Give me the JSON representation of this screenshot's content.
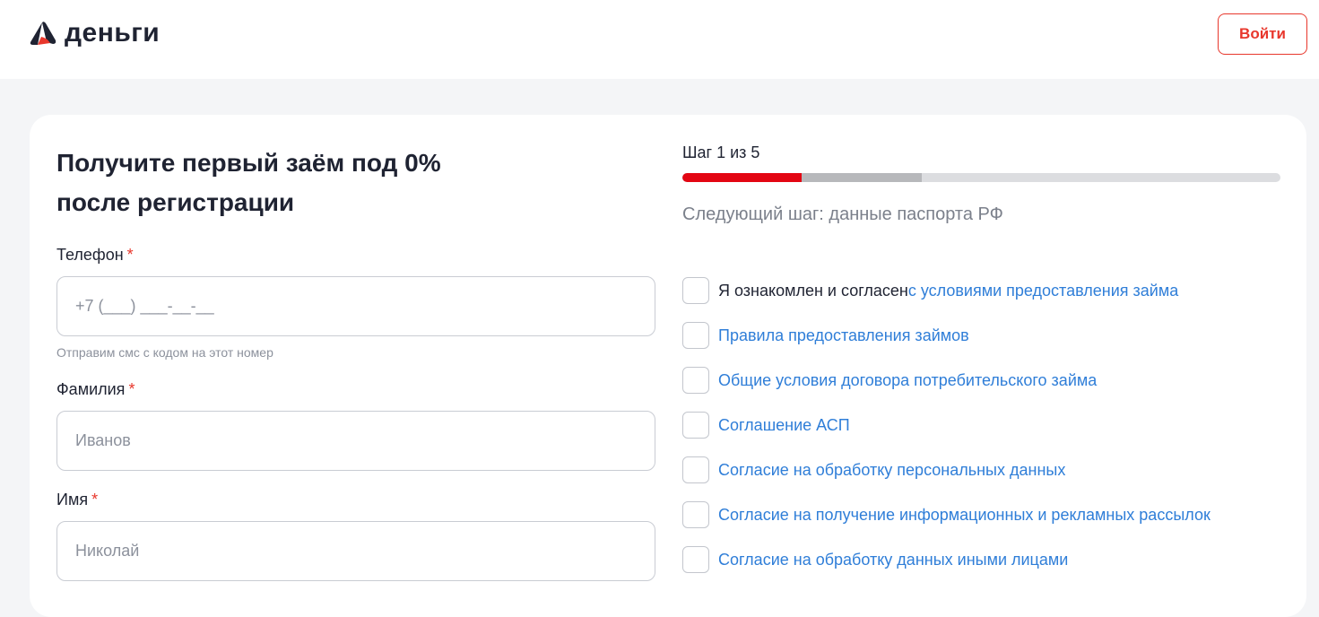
{
  "header": {
    "logo_text": "деньги",
    "login_label": "Войти"
  },
  "colors": {
    "accent": "#e8372c",
    "link": "#2f7ed8",
    "progress_active": "#e30613"
  },
  "form": {
    "title_line1": "Получите первый заём под 0%",
    "title_line2": "после регистрации",
    "phone": {
      "label": "Телефон",
      "required_mark": "*",
      "placeholder": "+7 (___) ___-__-__",
      "hint": "Отправим смс с кодом на этот номер"
    },
    "surname": {
      "label": "Фамилия",
      "required_mark": "*",
      "placeholder": "Иванов"
    },
    "name": {
      "label": "Имя",
      "required_mark": "*",
      "placeholder": "Николай"
    }
  },
  "progress": {
    "step_label": "Шаг 1 из 5",
    "current_step": 1,
    "total_steps": 5,
    "secondary_fill_fraction": 0.4,
    "next_step_text": "Следующий шаг: данные паспорта РФ"
  },
  "consents": [
    {
      "prefix": "Я ознакомлен и согласен ",
      "link": "с условиями предоставления займа",
      "checked": false
    },
    {
      "prefix": "",
      "link": "Правила предоставления займов",
      "checked": false
    },
    {
      "prefix": "",
      "link": "Общие условия договора потребительского займа",
      "checked": false
    },
    {
      "prefix": "",
      "link": "Соглашение АСП",
      "checked": false
    },
    {
      "prefix": "",
      "link": "Согласие на обработку персональных данных",
      "checked": false
    },
    {
      "prefix": "",
      "link": "Согласие на получение информационных и рекламных рассылок",
      "checked": false
    },
    {
      "prefix": "",
      "link": "Согласие на обработку данных иными лицами",
      "checked": false
    }
  ]
}
